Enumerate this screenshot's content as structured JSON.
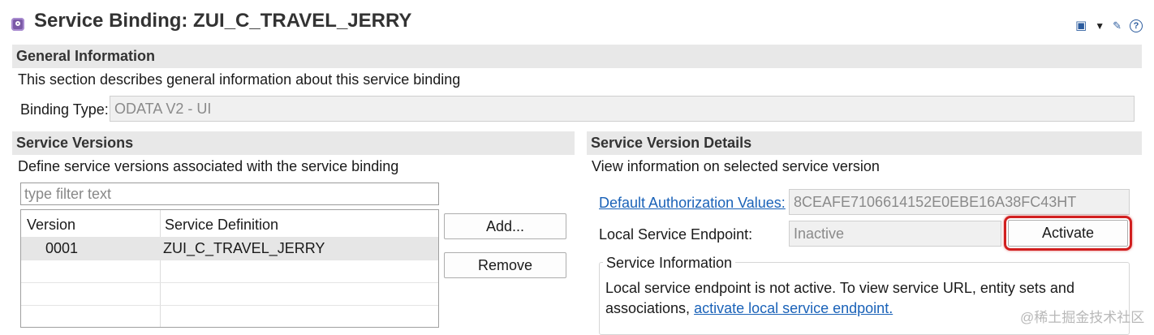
{
  "header": {
    "title": "Service Binding: ZUI_C_TRAVEL_JERRY",
    "help_label": "?"
  },
  "general": {
    "heading": "General Information",
    "description": "This section describes general information about this service binding",
    "binding_type_label": "Binding Type:",
    "binding_type_value": "ODATA V2 - UI"
  },
  "versions": {
    "heading": "Service Versions",
    "description": "Define service versions associated with the service binding",
    "filter_placeholder": "type filter text",
    "columns": [
      "Version",
      "Service Definition"
    ],
    "rows": [
      {
        "version": "0001",
        "definition": "ZUI_C_TRAVEL_JERRY"
      }
    ],
    "add_label": "Add...",
    "remove_label": "Remove"
  },
  "details": {
    "heading": "Service Version Details",
    "description": "View information on selected service version",
    "auth_link_label": "Default Authorization Values:",
    "auth_value": "8CEAFE7106614152E0EBE16A38FC43HT",
    "endpoint_label": "Local Service Endpoint:",
    "endpoint_value": "Inactive",
    "activate_label": "Activate",
    "info_legend": "Service Information",
    "info_text_1": "Local service endpoint is not active. To view service URL, entity sets and",
    "info_text_2_prefix": "associations, ",
    "info_link": "activate local service endpoint."
  },
  "watermark": "@稀土掘金技术社区",
  "colors": {
    "link": "#1a62b8",
    "highlight": "#d11f1f",
    "section_header_bg": "#e8e8e8"
  }
}
